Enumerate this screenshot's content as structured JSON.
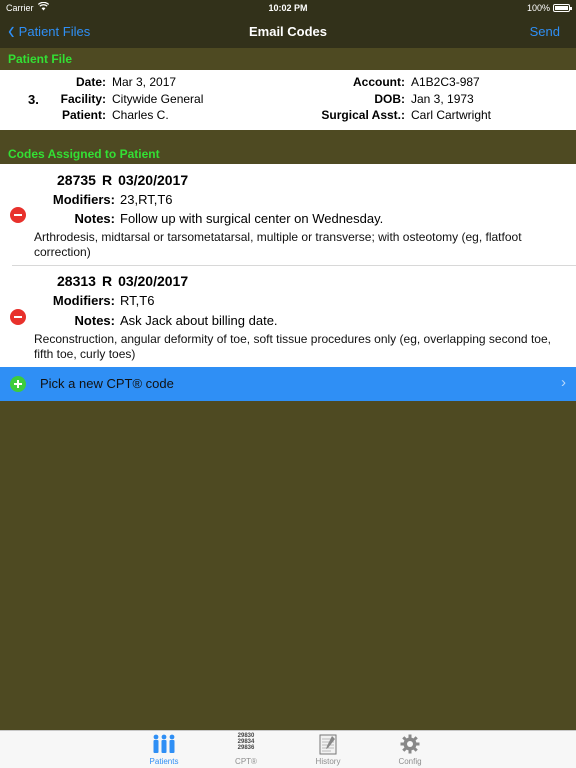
{
  "status_bar": {
    "carrier": "Carrier",
    "time": "10:02 PM",
    "battery": "100%"
  },
  "nav": {
    "back_label": "Patient Files",
    "title": "Email Codes",
    "send_label": "Send"
  },
  "patient_file": {
    "header": "Patient File",
    "number": "3.",
    "date_label": "Date:",
    "date": "Mar 3, 2017",
    "facility_label": "Facility:",
    "facility": "Citywide General",
    "patient_label": "Patient:",
    "patient": "Charles C.",
    "account_label": "Account:",
    "account": "A1B2C3-987",
    "dob_label": "DOB:",
    "dob": "Jan 3, 1973",
    "asst_label": "Surgical Asst.:",
    "asst": "Carl Cartwright"
  },
  "codes": {
    "header": "Codes Assigned to Patient",
    "items": [
      {
        "code": "28735",
        "side": "R",
        "date": "03/20/2017",
        "modifiers_label": "Modifiers:",
        "modifiers": "23,RT,T6",
        "notes_label": "Notes:",
        "notes": "Follow up with surgical center on Wednesday.",
        "description": "Arthrodesis, midtarsal or tarsometatarsal, multiple or transverse; with osteotomy (eg, flatfoot correction)"
      },
      {
        "code": "28313",
        "side": "R",
        "date": "03/20/2017",
        "modifiers_label": "Modifiers:",
        "modifiers": "RT,T6",
        "notes_label": "Notes:",
        "notes": "Ask Jack about billing date.",
        "description": "Reconstruction, angular deformity of toe, soft tissue procedures only (eg, overlapping second toe, fifth toe, curly toes)"
      }
    ]
  },
  "pick_new": {
    "label": "Pick a new CPT® code"
  },
  "tabs": [
    {
      "label": "Patients",
      "icon": "patients-icon",
      "active": true
    },
    {
      "label": "CPT®",
      "icon": "cpt-icon",
      "icon_text": [
        "29830",
        "29834",
        "29836"
      ]
    },
    {
      "label": "History",
      "icon": "history-icon"
    },
    {
      "label": "Config",
      "icon": "gear-icon"
    }
  ],
  "colors": {
    "accent": "#2f8ff5",
    "section_green": "#33e034",
    "background": "#4e4a22",
    "delete_red": "#e8312c",
    "add_green": "#3dcc3d"
  }
}
